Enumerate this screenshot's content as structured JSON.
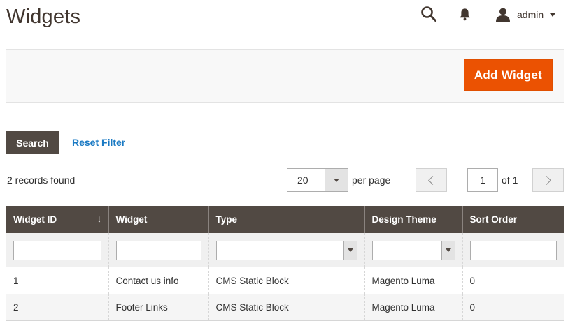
{
  "page": {
    "title": "Widgets"
  },
  "header": {
    "search_icon": "search-icon",
    "notifications_icon": "bell-icon",
    "user_icon": "user-icon",
    "user_name": "admin"
  },
  "actions": {
    "add_widget_label": "Add Widget",
    "accent_color": "#eb5202"
  },
  "filters": {
    "search_label": "Search",
    "reset_label": "Reset Filter"
  },
  "toolbar": {
    "records_found": "2 records found",
    "per_page_value": "20",
    "per_page_label": "per page",
    "current_page": "1",
    "total_pages_label": "of 1"
  },
  "grid": {
    "columns": [
      {
        "label": "Widget ID",
        "sorted": "descending"
      },
      {
        "label": "Widget"
      },
      {
        "label": "Type"
      },
      {
        "label": "Design Theme"
      },
      {
        "label": "Sort Order"
      }
    ],
    "rows": [
      {
        "id": "1",
        "widget": "Contact us info",
        "type": "CMS Static Block",
        "theme": "Magento Luma",
        "sort_order": "0"
      },
      {
        "id": "2",
        "widget": "Footer Links",
        "type": "CMS Static Block",
        "theme": "Magento Luma",
        "sort_order": "0"
      }
    ],
    "header_color": "#514943",
    "sort_indicator": "↓"
  }
}
